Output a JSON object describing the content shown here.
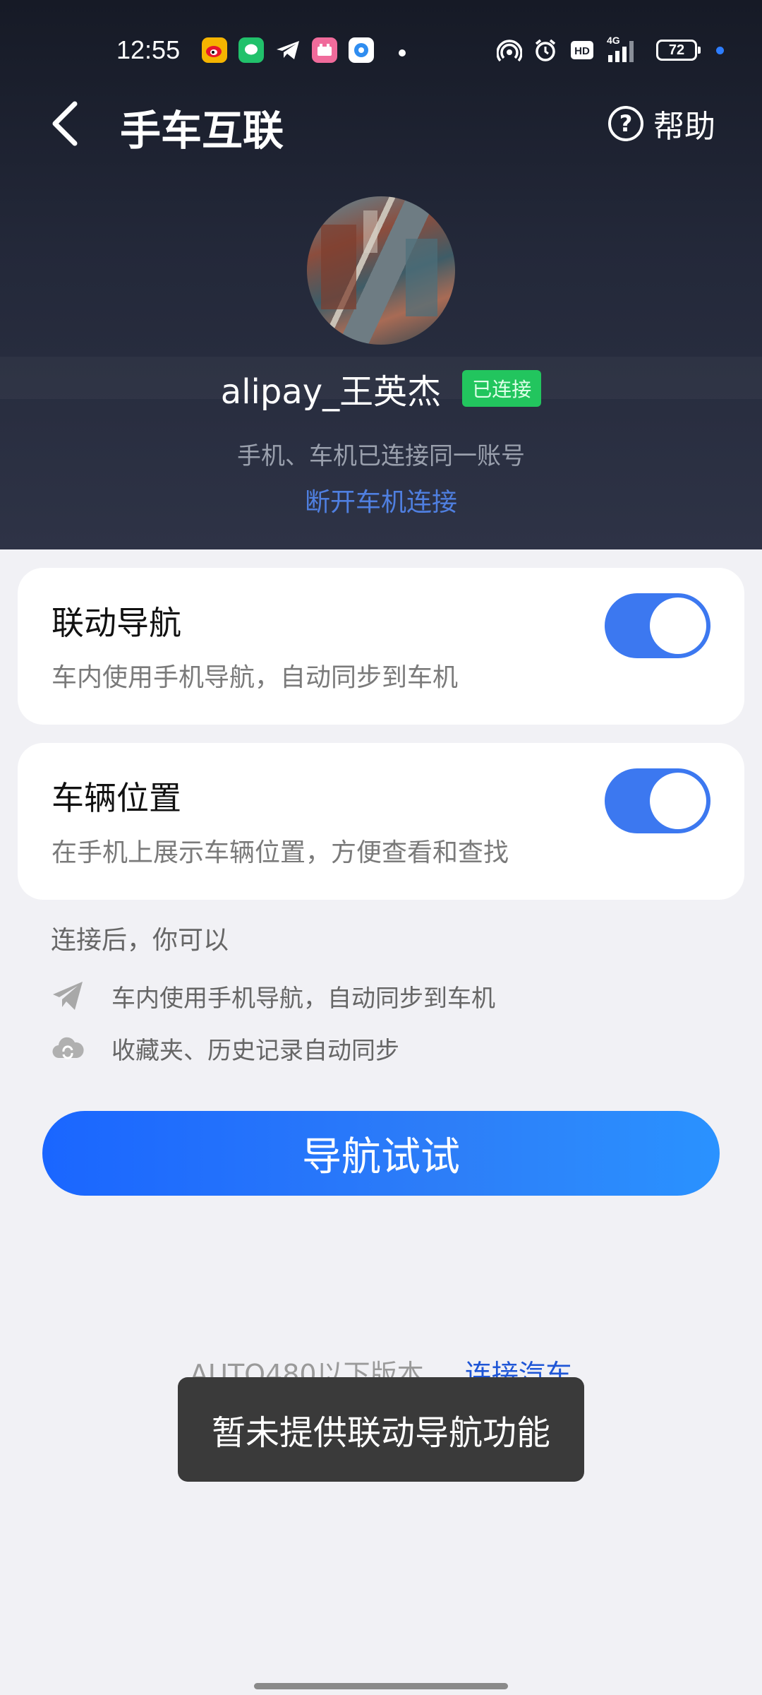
{
  "status_bar": {
    "time": "12:55",
    "battery": "72",
    "network": "4G",
    "hd": "HD"
  },
  "header": {
    "title": "手车互联",
    "help_label": "帮助"
  },
  "profile": {
    "username": "alipay_王英杰",
    "status_badge": "已连接",
    "subtitle": "手机、车机已连接同一账号",
    "disconnect_link": "断开车机连接"
  },
  "cards": [
    {
      "title": "联动导航",
      "description": "车内使用手机导航，自动同步到车机",
      "enabled": true
    },
    {
      "title": "车辆位置",
      "description": "在手机上展示车辆位置，方便查看和查找",
      "enabled": true
    }
  ],
  "features": {
    "heading": "连接后，你可以",
    "items": [
      {
        "icon": "paper-plane-icon",
        "text": "车内使用手机导航，自动同步到车机"
      },
      {
        "icon": "cloud-sync-icon",
        "text": "收藏夹、历史记录自动同步"
      }
    ]
  },
  "primary_button": "导航试试",
  "footer": {
    "note": "AUTO480以下版本...",
    "link": "连接汽车"
  },
  "toast": "暂未提供联动导航功能",
  "colors": {
    "accent": "#3c78f0",
    "button_gradient_start": "#1a66ff",
    "button_gradient_end": "#2a92ff",
    "badge_green": "#22c55e",
    "header_dark": "#1c2130"
  }
}
